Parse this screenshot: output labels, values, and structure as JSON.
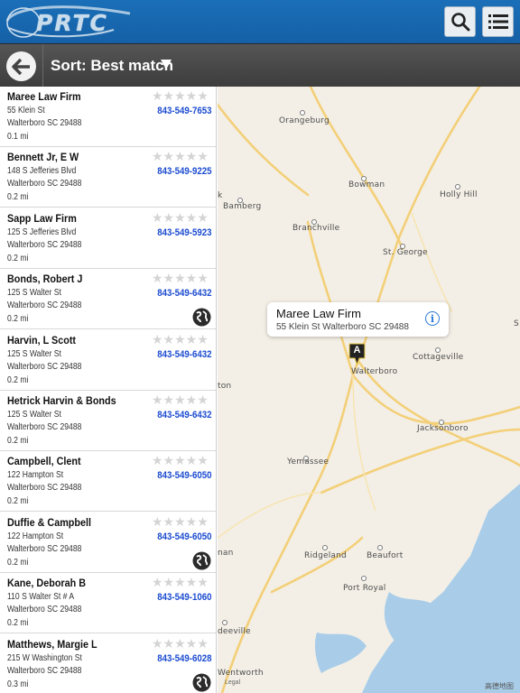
{
  "header": {
    "logo_text": "PRTC",
    "search_icon": "search-icon",
    "menu_icon": "menu-icon"
  },
  "sortbar": {
    "back_icon": "back-arrow-icon",
    "label": "Sort: Best match",
    "caret_icon": "caret-down-icon"
  },
  "results": [
    {
      "name": "Maree Law Firm",
      "street": "55 Klein St",
      "city": "Walterboro SC 29488",
      "distance": "0.1 mi",
      "phone": "843-549-7653",
      "rating": 0,
      "website": false
    },
    {
      "name": "Bennett Jr, E W",
      "street": "148 S Jefferies Blvd",
      "city": "Walterboro SC 29488",
      "distance": "0.2 mi",
      "phone": "843-549-9225",
      "rating": 0,
      "website": false
    },
    {
      "name": "Sapp Law Firm",
      "street": "125 S Jefferies Blvd",
      "city": "Walterboro SC 29488",
      "distance": "0.2 mi",
      "phone": "843-549-5923",
      "rating": 0,
      "website": false
    },
    {
      "name": "Bonds, Robert J",
      "street": "125 S Walter St",
      "city": "Walterboro SC 29488",
      "distance": "0.2 mi",
      "phone": "843-549-6432",
      "rating": 0,
      "website": true
    },
    {
      "name": "Harvin, L Scott",
      "street": "125 S Walter St",
      "city": "Walterboro SC 29488",
      "distance": "0.2 mi",
      "phone": "843-549-6432",
      "rating": 0,
      "website": false
    },
    {
      "name": "Hetrick Harvin & Bonds",
      "street": "125 S Walter St",
      "city": "Walterboro SC 29488",
      "distance": "0.2 mi",
      "phone": "843-549-6432",
      "rating": 0,
      "website": false
    },
    {
      "name": "Campbell, Clent",
      "street": "122 Hampton St",
      "city": "Walterboro SC 29488",
      "distance": "0.2 mi",
      "phone": "843-549-6050",
      "rating": 0,
      "website": false
    },
    {
      "name": "Duffie & Campbell",
      "street": "122 Hampton St",
      "city": "Walterboro SC 29488",
      "distance": "0.2 mi",
      "phone": "843-549-6050",
      "rating": 0,
      "website": true
    },
    {
      "name": "Kane, Deborah B",
      "street": "110 S Walter St # A",
      "city": "Walterboro SC 29488",
      "distance": "0.2 mi",
      "phone": "843-549-1060",
      "rating": 0,
      "website": false
    },
    {
      "name": "Matthews, Margie L",
      "street": "215 W Washington St",
      "city": "Walterboro SC 29488",
      "distance": "0.3 mi",
      "phone": "843-549-6028",
      "rating": 0,
      "website": true
    }
  ],
  "map": {
    "cities": [
      "Orangeburg",
      "Bowman",
      "Holly Hill",
      "Bamberg",
      "Branchville",
      "St. George",
      "Cottageville",
      "Walterboro",
      "Jacksonboro",
      "Yemassee",
      "Ridgeland",
      "Beaufort",
      "Port Royal",
      "Wentworth",
      "ton",
      "nan",
      "deeville",
      "k",
      "S"
    ],
    "callout": {
      "title": "Maree Law Firm",
      "address": "55 Klein St Walterboro SC 29488",
      "info_icon": "info-icon",
      "info_label": "i"
    },
    "pin_label": "A",
    "legal": "Legal",
    "attribution": "高德地图",
    "colors": {
      "road": "#f7d98a",
      "water": "#a9cde9",
      "land": "#f3efe6"
    }
  }
}
